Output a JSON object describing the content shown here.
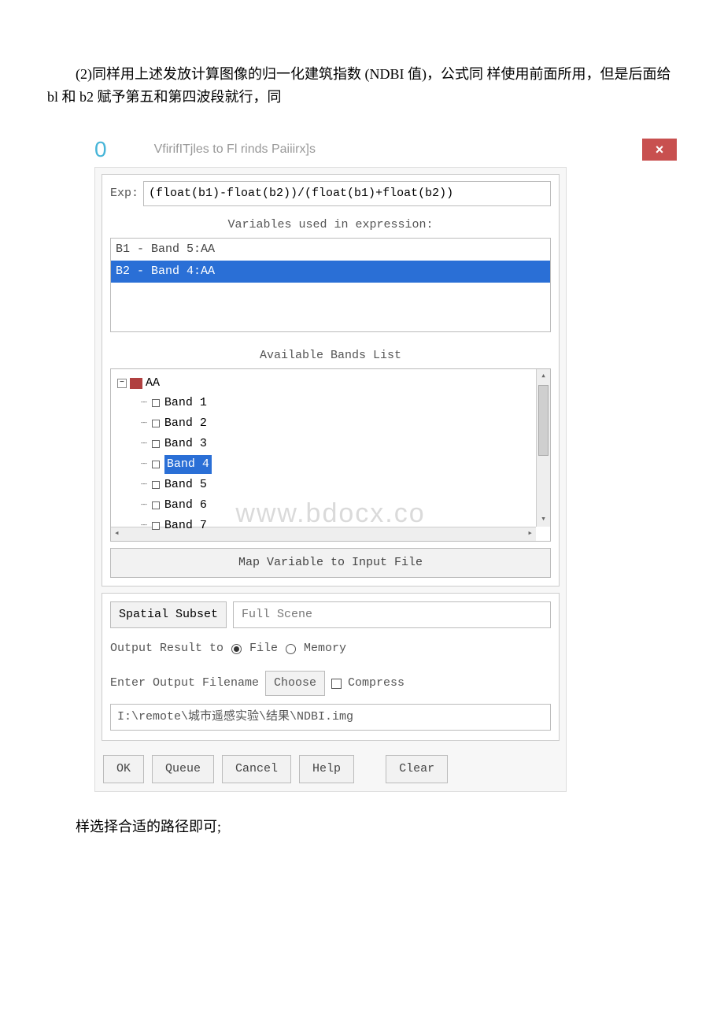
{
  "intro": "(2)同样用上述发放计算图像的归一化建筑指数 (NDBI 值)，公式同 样使用前面所用，但是后面给 bl 和 b2 赋予第五和第四波段就行，同",
  "header": {
    "zero": "0",
    "title": "VfirifITjles to Fl rinds Paiiirx]s",
    "close": "×"
  },
  "exp": {
    "label": "Exp:",
    "value": "(float(b1)-float(b2))/(float(b1)+float(b2))"
  },
  "vars": {
    "label": "Variables used in expression:",
    "items": [
      {
        "text": "B1 - Band 5:AA",
        "selected": false
      },
      {
        "text": "B2 - Band 4:AA",
        "selected": true
      }
    ]
  },
  "bands": {
    "label": "Available Bands List",
    "root": "AA",
    "items": [
      {
        "name": "Band 1",
        "selected": false
      },
      {
        "name": "Band 2",
        "selected": false
      },
      {
        "name": "Band 3",
        "selected": false
      },
      {
        "name": "Band 4",
        "selected": true
      },
      {
        "name": "Band 5",
        "selected": false
      },
      {
        "name": "Band 6",
        "selected": false
      },
      {
        "name": "Band 7",
        "selected": false
      }
    ]
  },
  "watermark": "www.bdocx.co",
  "map_button": "Map Variable to Input File",
  "subset": {
    "button": "Spatial Subset",
    "value": "Full Scene"
  },
  "output": {
    "label": "Output Result to",
    "file": "File",
    "memory": "Memory"
  },
  "filename": {
    "label": "Enter Output Filename",
    "choose": "Choose",
    "compress": "Compress",
    "path": "I:\\remote\\城市遥感实验\\结果\\NDBI.img"
  },
  "buttons": {
    "ok": "OK",
    "queue": "Queue",
    "cancel": "Cancel",
    "help": "Help",
    "clear": "Clear"
  },
  "outro": "样选择合适的路径即可;"
}
